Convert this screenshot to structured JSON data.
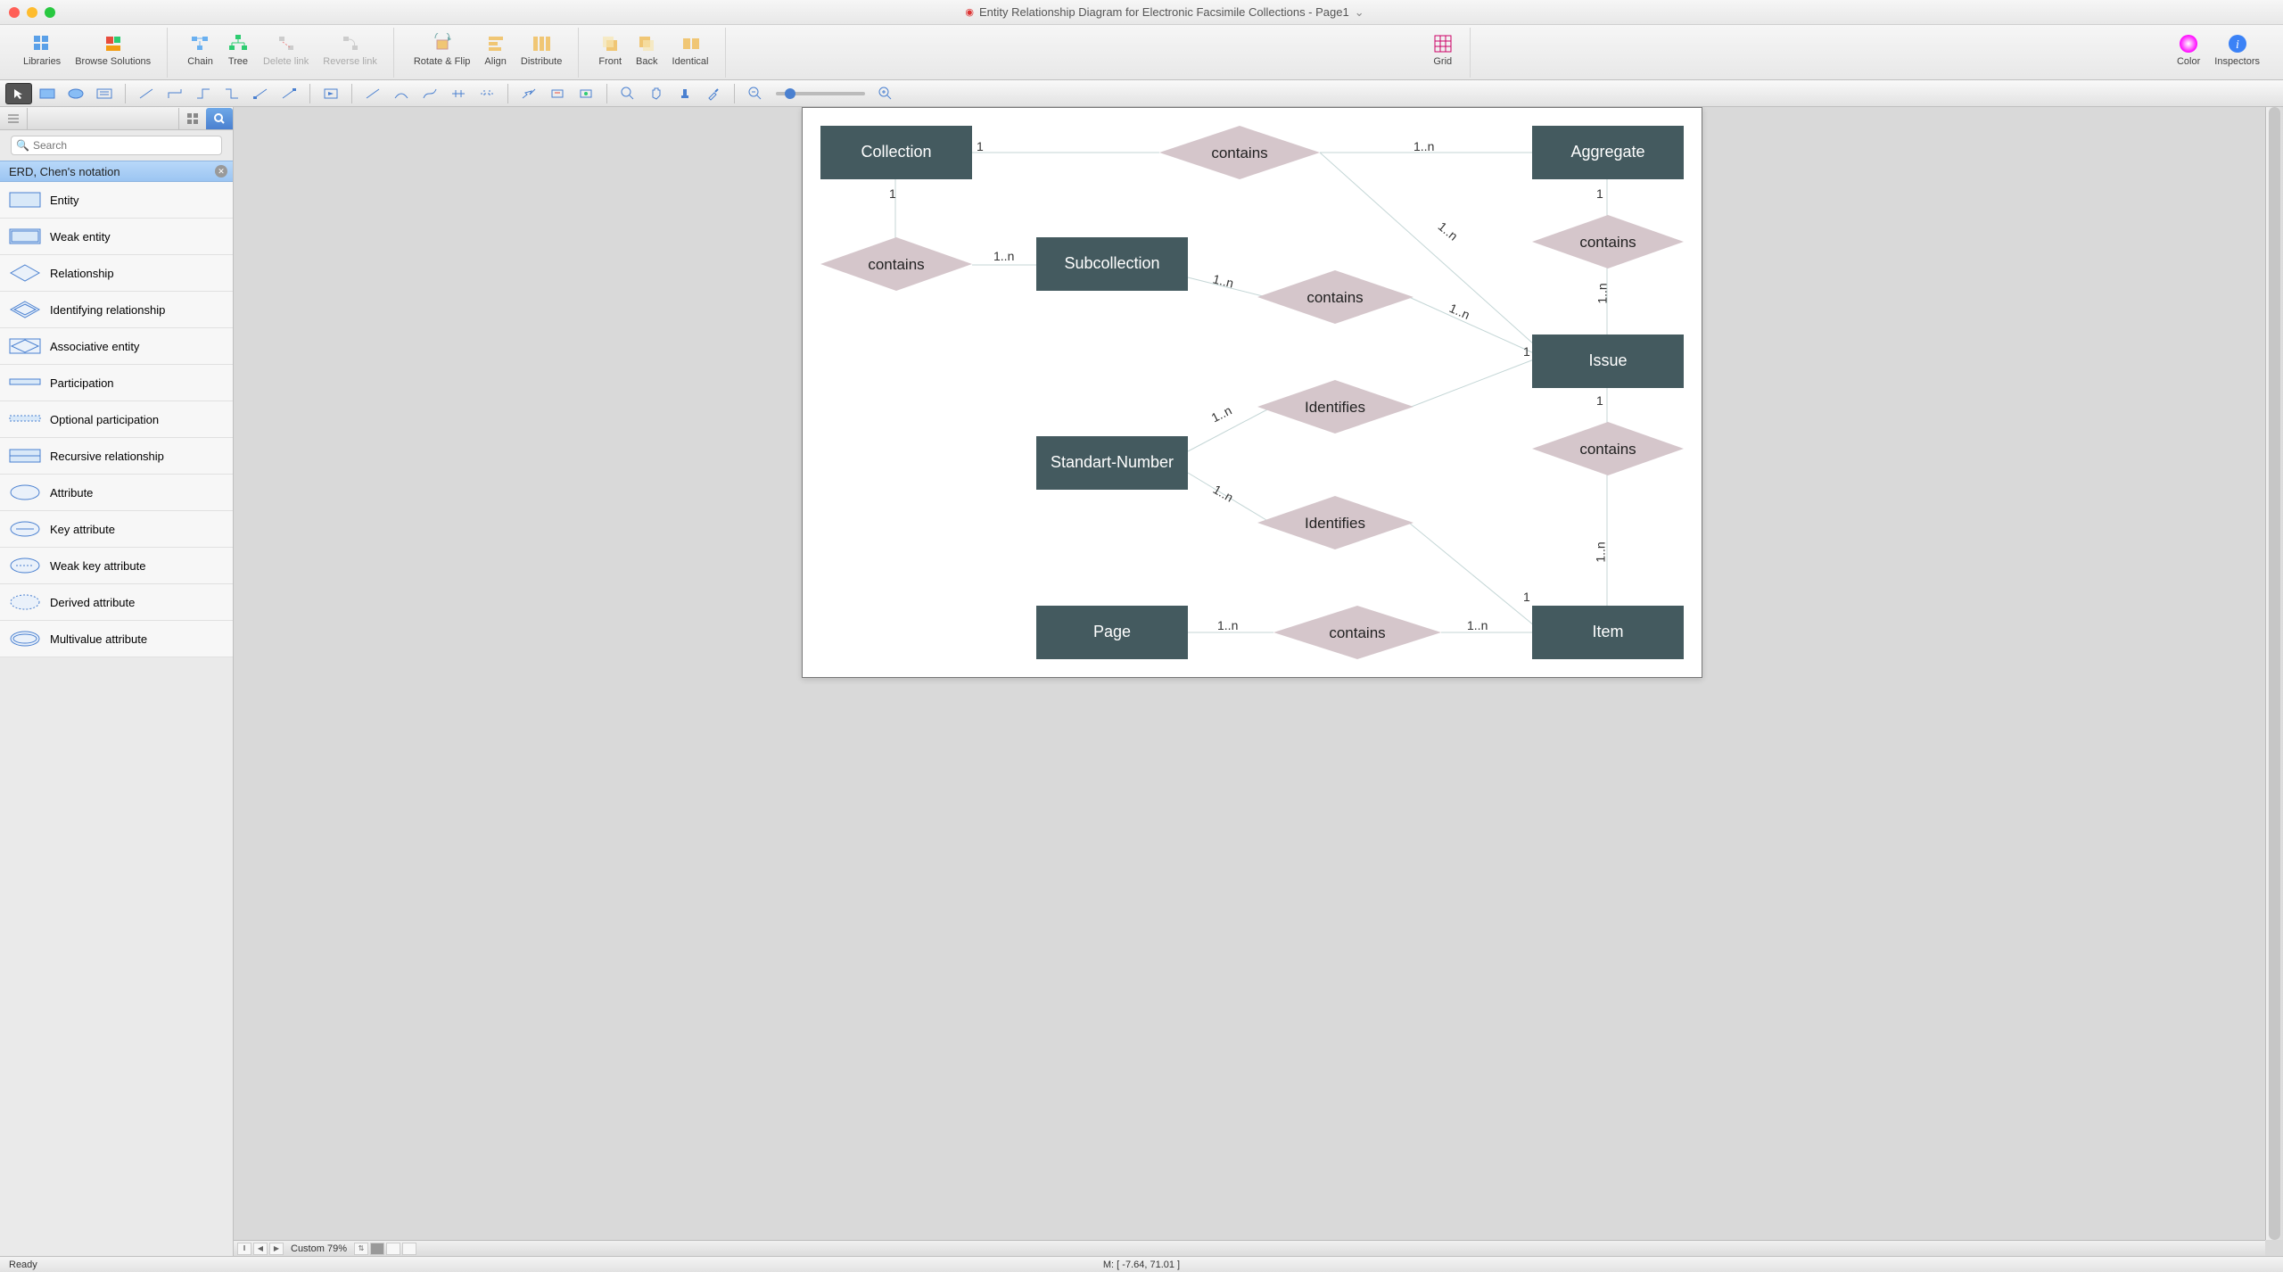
{
  "window": {
    "title": "Entity Relationship Diagram for Electronic Facsimile Collections - Page1"
  },
  "toolbar": {
    "libraries": "Libraries",
    "browse": "Browse Solutions",
    "chain": "Chain",
    "tree": "Tree",
    "delete_link": "Delete link",
    "reverse_link": "Reverse link",
    "rotate_flip": "Rotate & Flip",
    "align": "Align",
    "distribute": "Distribute",
    "front": "Front",
    "back": "Back",
    "identical": "Identical",
    "grid": "Grid",
    "color": "Color",
    "inspectors": "Inspectors"
  },
  "sidebar": {
    "search_placeholder": "Search",
    "section": "ERD, Chen's notation",
    "items": [
      {
        "label": "Entity"
      },
      {
        "label": "Weak entity"
      },
      {
        "label": "Relationship"
      },
      {
        "label": "Identifying relationship"
      },
      {
        "label": "Associative entity"
      },
      {
        "label": "Participation"
      },
      {
        "label": "Optional participation"
      },
      {
        "label": "Recursive relationship"
      },
      {
        "label": "Attribute"
      },
      {
        "label": "Key attribute"
      },
      {
        "label": "Weak key attribute"
      },
      {
        "label": "Derived attribute"
      },
      {
        "label": "Multivalue attribute"
      }
    ]
  },
  "diagram": {
    "entities": {
      "collection": "Collection",
      "aggregate": "Aggregate",
      "subcollection": "Subcollection",
      "issue": "Issue",
      "standart_number": "Standart-Number",
      "page": "Page",
      "item": "Item"
    },
    "relationships": {
      "contains1": "contains",
      "contains2": "contains",
      "contains3": "contains",
      "contains4": "contains",
      "identifies1": "Identifies",
      "identifies2": "Identifies",
      "contains5": "contains",
      "contains6": "contains"
    },
    "cards": {
      "c1": "1",
      "c1n": "1..n"
    }
  },
  "hscroll": {
    "zoom": "Custom 79%"
  },
  "status": {
    "ready": "Ready",
    "coords": "M: [ -7.64, 71.01 ]"
  }
}
